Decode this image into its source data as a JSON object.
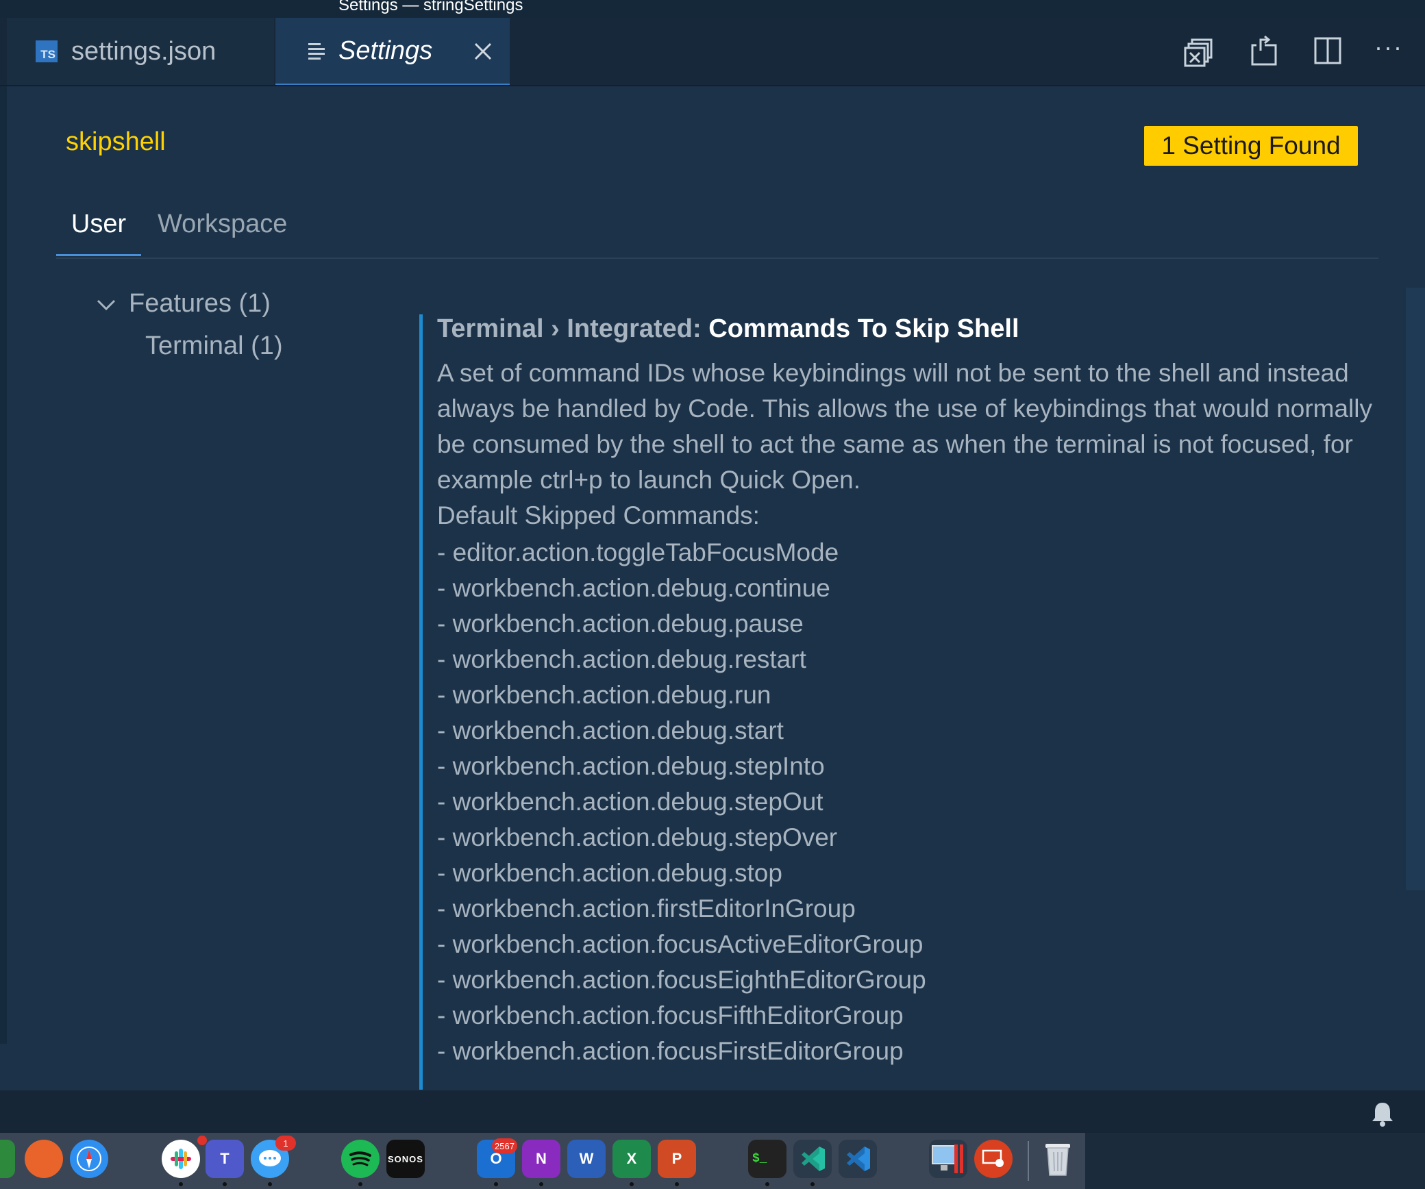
{
  "window": {
    "title": "Settings — stringSettings"
  },
  "tabs": [
    {
      "label": "settings.json",
      "icon": "typescript-file-icon",
      "icon_text": "TS"
    },
    {
      "label": "Settings",
      "icon": "settings-lines-icon"
    }
  ],
  "toolbar": {
    "icons": [
      "close-all-icon",
      "open-settings-json-icon",
      "split-editor-icon",
      "more-actions-icon"
    ],
    "more_label": "···"
  },
  "search": {
    "query": "skipshell",
    "result_badge": "1 Setting Found"
  },
  "scopes": {
    "user": "User",
    "workspace": "Workspace"
  },
  "toc": {
    "group": "Features (1)",
    "item": "Terminal (1)"
  },
  "setting": {
    "category": "Terminal › Integrated: ",
    "name": "Commands To Skip Shell",
    "description": "A set of command IDs whose keybindings will not be sent to the shell and instead always be handled by Code. This allows the use of keybindings that would normally be consumed by the shell to act the same as when the terminal is not focused, for example ctrl+p to launch Quick Open.",
    "default_header": "Default Skipped Commands:",
    "commands": [
      "- editor.action.toggleTabFocusMode",
      "- workbench.action.debug.continue",
      "- workbench.action.debug.pause",
      "- workbench.action.debug.restart",
      "- workbench.action.debug.run",
      "- workbench.action.debug.start",
      "- workbench.action.debug.stepInto",
      "- workbench.action.debug.stepOut",
      "- workbench.action.debug.stepOver",
      "- workbench.action.debug.stop",
      "- workbench.action.firstEditorInGroup",
      "- workbench.action.focusActiveEditorGroup",
      "- workbench.action.focusEighthEditorGroup",
      "- workbench.action.focusFifthEditorGroup",
      "- workbench.action.focusFirstEditorGroup"
    ]
  },
  "statusbar": {
    "icon": "bell-icon"
  },
  "dock": {
    "apps": [
      {
        "name": "firefox",
        "label": ""
      },
      {
        "name": "safari",
        "label": ""
      },
      {
        "name": "slack",
        "label": ""
      },
      {
        "name": "teams",
        "label": "T"
      },
      {
        "name": "messages",
        "label": "",
        "badge": "1"
      },
      {
        "name": "spotify",
        "label": ""
      },
      {
        "name": "sonos",
        "label": "SONOS"
      },
      {
        "name": "outlook",
        "label": "O",
        "badge": "2567"
      },
      {
        "name": "onenote",
        "label": "N"
      },
      {
        "name": "word",
        "label": "W"
      },
      {
        "name": "excel",
        "label": "X"
      },
      {
        "name": "powerpoint",
        "label": "P"
      },
      {
        "name": "terminal",
        "label": "$_"
      },
      {
        "name": "vscode-insiders",
        "label": ""
      },
      {
        "name": "vscode",
        "label": ""
      },
      {
        "name": "parallels",
        "label": ""
      },
      {
        "name": "remote-desktop",
        "label": ""
      },
      {
        "name": "trash",
        "label": ""
      }
    ]
  },
  "colors": {
    "accent": "#ffcc00",
    "query": "#ffd200",
    "focus_bar": "#1e8bd1",
    "editor_bg": "#1b3249"
  }
}
